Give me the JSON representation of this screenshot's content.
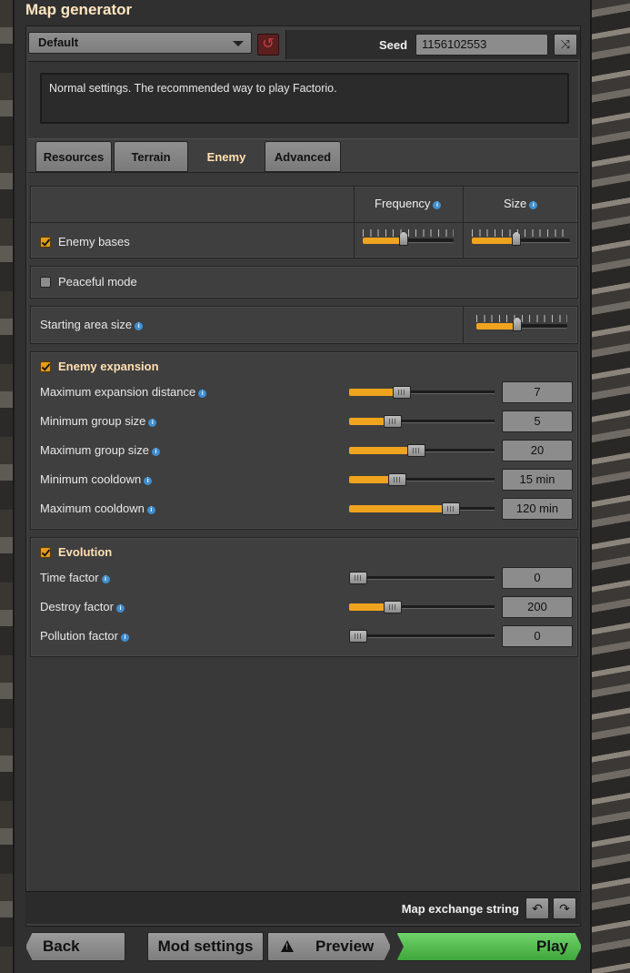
{
  "window": {
    "title": "Map generator"
  },
  "preset": {
    "selected": "Default",
    "description": "Normal settings. The recommended way to play Factorio."
  },
  "seed": {
    "label": "Seed",
    "value": "1156102553"
  },
  "tabs": [
    {
      "label": "Resources",
      "active": false
    },
    {
      "label": "Terrain",
      "active": false
    },
    {
      "label": "Enemy",
      "active": true
    },
    {
      "label": "Advanced",
      "active": false
    }
  ],
  "table": {
    "col_frequency": "Frequency",
    "col_size": "Size"
  },
  "enemy_bases": {
    "label": "Enemy bases",
    "checked": true,
    "frequency_level": 0.45,
    "size_level": 0.45
  },
  "peaceful": {
    "label": "Peaceful mode",
    "checked": false
  },
  "starting_area": {
    "label": "Starting area size",
    "level": 0.45
  },
  "expansion": {
    "title": "Enemy expansion",
    "checked": true,
    "rows": [
      {
        "label": "Maximum expansion distance",
        "value": "7",
        "fill": 0.3
      },
      {
        "label": "Minimum group size",
        "value": "5",
        "fill": 0.24
      },
      {
        "label": "Maximum group size",
        "value": "20",
        "fill": 0.4
      },
      {
        "label": "Minimum cooldown",
        "value": "15 min",
        "fill": 0.27
      },
      {
        "label": "Maximum cooldown",
        "value": "120 min",
        "fill": 0.64
      }
    ]
  },
  "evolution": {
    "title": "Evolution",
    "checked": true,
    "rows": [
      {
        "label": "Time factor",
        "value": "0",
        "fill": 0.0
      },
      {
        "label": "Destroy factor",
        "value": "200",
        "fill": 0.24
      },
      {
        "label": "Pollution factor",
        "value": "0",
        "fill": 0.0
      }
    ]
  },
  "exchange": {
    "label": "Map exchange string"
  },
  "buttons": {
    "back": "Back",
    "mod_settings": "Mod settings",
    "preview": "Preview",
    "play": "Play"
  },
  "colors": {
    "accent_orange": "#f0a41e",
    "play_green": "#5cc257",
    "title_text": "#ffe6c0"
  }
}
